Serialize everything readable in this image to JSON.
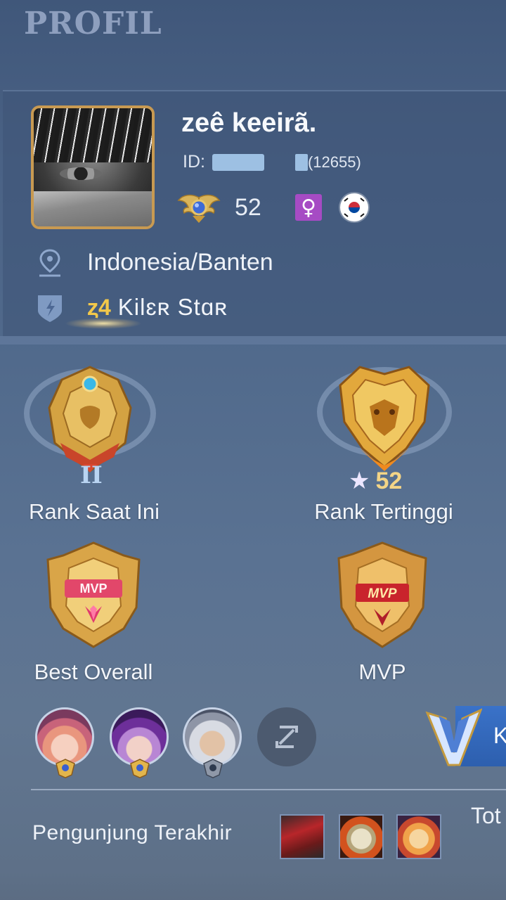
{
  "header": {
    "title": "PROFIL"
  },
  "profile": {
    "username": "zeê keeirã.",
    "id_label": "ID:",
    "server": "(12655)",
    "level": "52",
    "gender_symbol": "♀",
    "flag_icon": "south-korea-flag-icon",
    "location": "Indonesia/Banten",
    "squad_tag": "ȥ4",
    "squad_name": "Kilɛʀ Stɑʀ"
  },
  "medals": {
    "current_rank_label": "Rank Saat Ini",
    "current_rank_tier": "II",
    "highest_rank_label": "Rank Tertinggi",
    "highest_rank_stars": "52",
    "star_symbol": "★",
    "best_overall_label": "Best Overall",
    "mvp_label": "MVP",
    "mvp_badge_text": "MVP"
  },
  "favorite_heroes": [
    {
      "icon": "hero-portrait-pink-hair"
    },
    {
      "icon": "hero-portrait-purple-hair"
    },
    {
      "icon": "hero-portrait-white-hair"
    }
  ],
  "side_tab": {
    "text": "K"
  },
  "visitors": {
    "label": "Pengunjung Terakhir",
    "total_text": "Tot"
  },
  "colors": {
    "accent_gold": "#f3d486",
    "gender_purple": "#a64bc4",
    "avatar_border": "#c89a52",
    "side_tab_blue": "#2d5fae"
  }
}
